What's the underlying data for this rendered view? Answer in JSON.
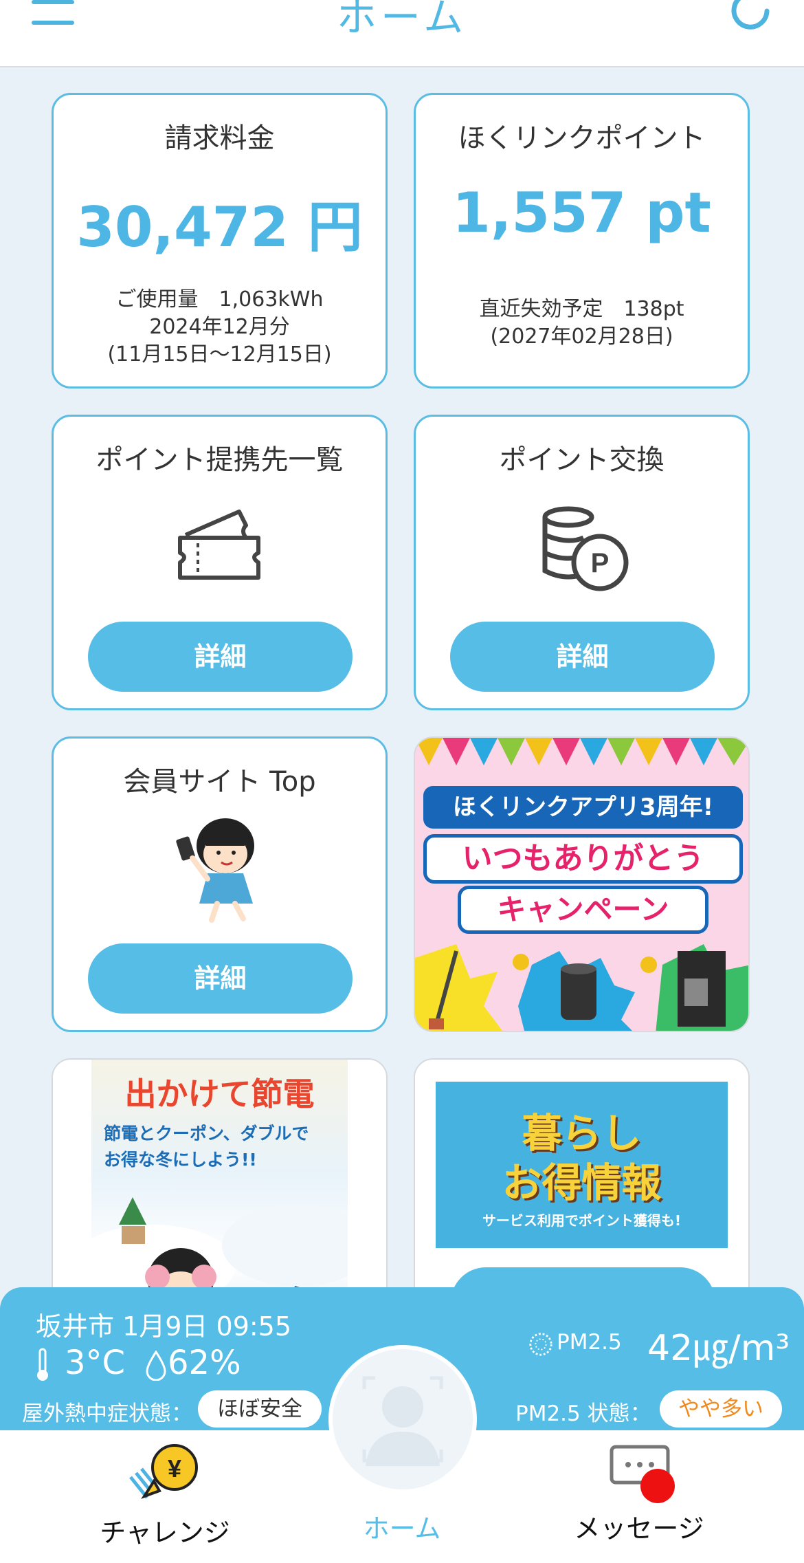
{
  "header": {
    "title": "ホーム"
  },
  "cards": {
    "bill": {
      "title": "請求料金",
      "value": "30,472 円",
      "usage": "ご使用量　1,063kWh",
      "month": "2024年12月分",
      "period": "(11月15日〜12月15日)"
    },
    "points": {
      "title": "ほくリンクポイント",
      "value": "1,557 pt",
      "expiry": "直近失効予定　138pt",
      "expiry_date": "(2027年02月28日)"
    },
    "partners": {
      "title": "ポイント提携先一覧",
      "button": "詳細",
      "icon": "ticket-icon"
    },
    "exchange": {
      "title": "ポイント交換",
      "button": "詳細",
      "icon": "coins-p-icon"
    },
    "member": {
      "title": "会員サイト Top",
      "button": "詳細",
      "icon": "character-phone-icon"
    }
  },
  "banners": {
    "campaign": {
      "line1": "ほくリンクアプリ3周年!",
      "line2": "いつもありがとう",
      "line3": "キャンペーン"
    },
    "outing": {
      "title": "出かけて節電",
      "sub1": "節電とクーポン、ダブルで",
      "sub2": "お得な冬にしよう!!"
    },
    "living": {
      "title1": "暮らし",
      "title2": "お得情報",
      "sub": "サービス利用でポイント獲得も!"
    }
  },
  "weather": {
    "location_time": "坂井市 1月9日 09:55",
    "temperature": "3°C",
    "humidity": "62%",
    "heat_label": "屋外熱中症状態：",
    "heat_status": "ほぼ安全",
    "pm_label": "PM2.5",
    "pm_value": "42㎍/m³",
    "pm_state_label": "PM2.5 状態：",
    "pm_state": "やや多い"
  },
  "nav": {
    "challenge": "チャレンジ",
    "home": "ホーム",
    "messages": "メッセージ"
  },
  "colors": {
    "accent": "#55bde6",
    "pm_state": "#f08a1c",
    "badge": "#ee1111"
  }
}
